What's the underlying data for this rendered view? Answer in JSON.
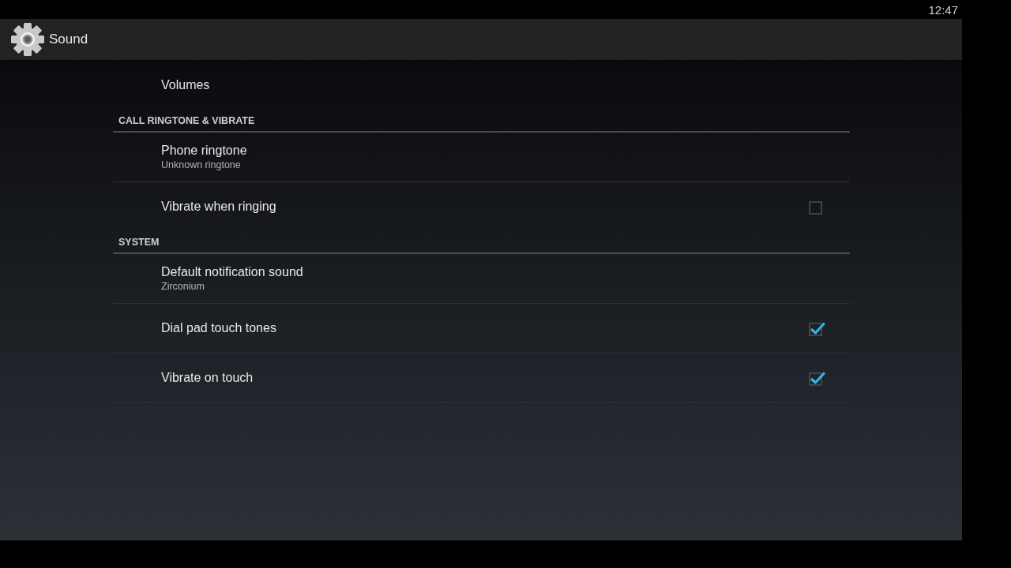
{
  "status_bar": {
    "time": "12:47"
  },
  "action_bar": {
    "title": "Sound"
  },
  "list": [
    {
      "kind": "link",
      "title": "Volumes"
    }
  ],
  "sections": [
    {
      "header": "CALL RINGTONE & VIBRATE",
      "items": [
        {
          "kind": "link",
          "title": "Phone ringtone",
          "summary": "Unknown ringtone"
        },
        {
          "kind": "checkbox",
          "title": "Vibrate when ringing",
          "checked": false
        }
      ]
    },
    {
      "header": "SYSTEM",
      "items": [
        {
          "kind": "link",
          "title": "Default notification sound",
          "summary": "Zirconium"
        },
        {
          "kind": "checkbox",
          "title": "Dial pad touch tones",
          "checked": true
        },
        {
          "kind": "checkbox",
          "title": "Vibrate on touch",
          "checked": true
        }
      ]
    }
  ]
}
